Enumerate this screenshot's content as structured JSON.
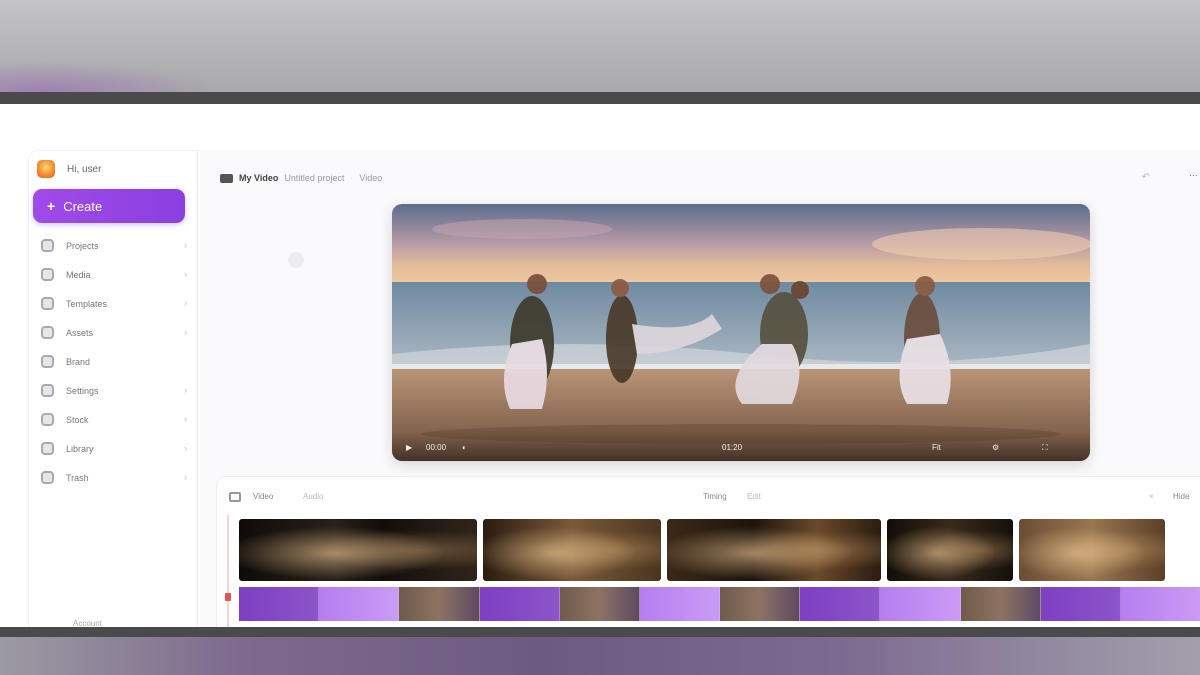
{
  "sidebar": {
    "brand": "Hi, user",
    "new_button": "Create",
    "items": [
      {
        "label": "Projects"
      },
      {
        "label": "Media"
      },
      {
        "label": "Templates"
      },
      {
        "label": "Assets"
      },
      {
        "label": "Brand"
      },
      {
        "label": "Settings"
      },
      {
        "label": "Stock"
      },
      {
        "label": "Library"
      },
      {
        "label": "Trash"
      }
    ],
    "footer": "Account"
  },
  "header": {
    "title": "My Video",
    "subtitle": "Untitled project",
    "crumb": "Video"
  },
  "player": {
    "time_current": "00:00",
    "time_total": "01:20",
    "zoom": "Fit"
  },
  "timeline": {
    "label_a": "Video",
    "label_b": "Audio",
    "mid_a": "Timing",
    "mid_b": "Edit",
    "right_label": "Hide"
  },
  "colors": {
    "accent": "#9b47e6",
    "timeline_marker": "#e05656"
  }
}
